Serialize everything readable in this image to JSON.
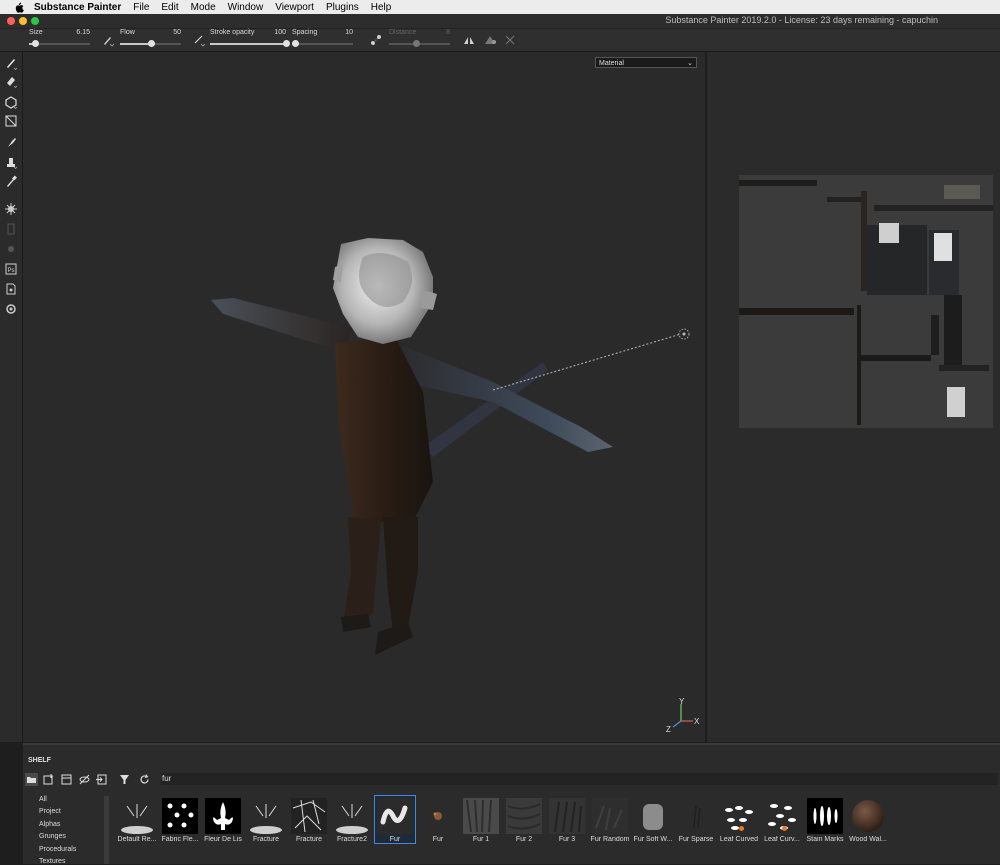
{
  "menubar": {
    "app": "Substance Painter",
    "items": [
      "File",
      "Edit",
      "Mode",
      "Window",
      "Viewport",
      "Plugins",
      "Help"
    ]
  },
  "window": {
    "title": "Substance Painter 2019.2.0 - License: 23 days remaining - capuchin"
  },
  "toolbar": {
    "size": {
      "label": "Size",
      "value": "6.15",
      "level": 0.1
    },
    "flow": {
      "label": "Flow",
      "value": "50",
      "level": 0.5
    },
    "stroke_opacity": {
      "label": "Stroke opacity",
      "value": "100",
      "level": 1.0
    },
    "spacing": {
      "label": "Spacing",
      "value": "10",
      "level": 0.05
    },
    "distance": {
      "label": "Distance",
      "value": "8",
      "level": 0.45
    }
  },
  "viewport": {
    "material_select": "Material",
    "axis": {
      "x": "X",
      "y": "Y",
      "z": "Z"
    }
  },
  "shelf": {
    "title": "SHELF",
    "search": "fur",
    "categories": [
      "All",
      "Project",
      "Alphas",
      "Grunges",
      "Procedurals",
      "Textures"
    ],
    "items": [
      {
        "label": "Default Re..."
      },
      {
        "label": "Fabric Fle..."
      },
      {
        "label": "Fleur De Lis"
      },
      {
        "label": "Fracture"
      },
      {
        "label": "Fracture"
      },
      {
        "label": "Fracture2"
      },
      {
        "label": "Fur"
      },
      {
        "label": "Fur"
      },
      {
        "label": "Fur 1"
      },
      {
        "label": "Fur 2"
      },
      {
        "label": "Fur 3"
      },
      {
        "label": "Fur Random"
      },
      {
        "label": "Fur Soft W..."
      },
      {
        "label": "Fur Sparse"
      },
      {
        "label": "Leaf Curved"
      },
      {
        "label": "Leaf Curv..."
      },
      {
        "label": "Stain Marks"
      },
      {
        "label": "Wood Wal..."
      }
    ]
  },
  "colors": {
    "selection": "#3d8be0",
    "accent": "#e87b27"
  }
}
